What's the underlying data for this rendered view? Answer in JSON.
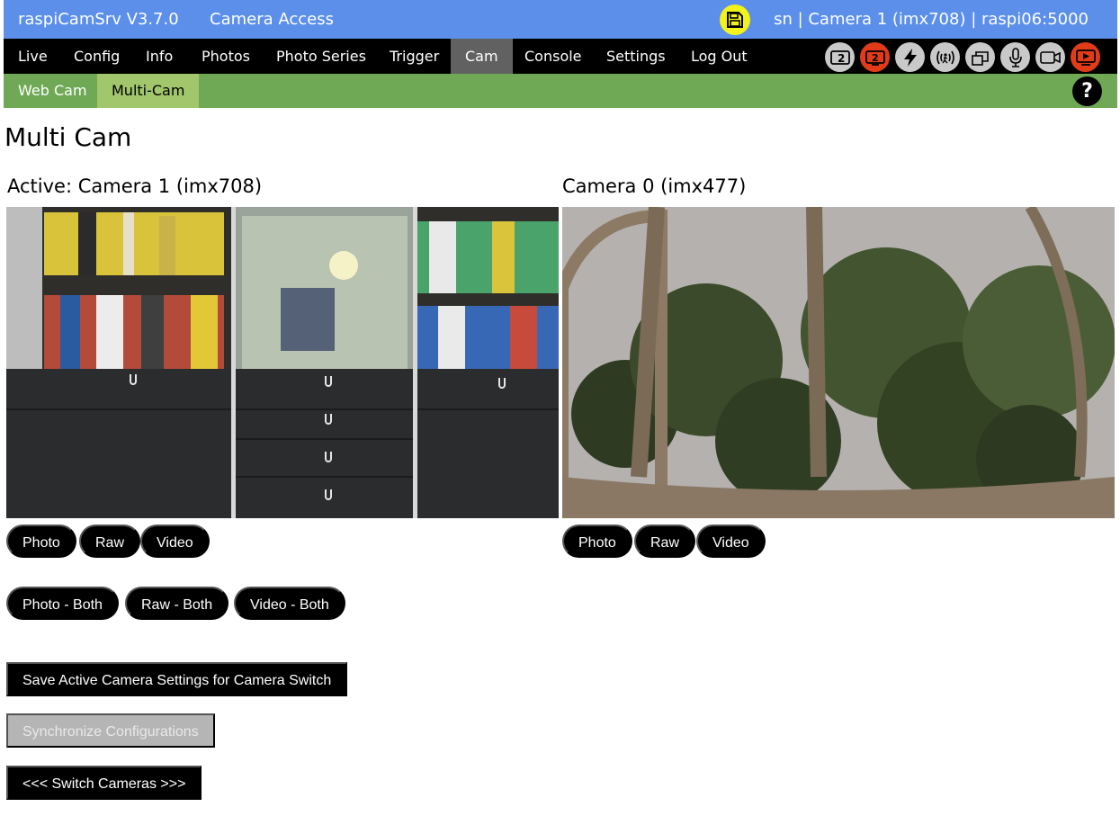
{
  "header": {
    "app_title": "raspiCamSrv V3.7.0",
    "page_name": "Camera Access",
    "status": "sn | Camera 1 (imx708) | raspi06:5000",
    "save_icon": "floppy-disk-icon"
  },
  "mainnav": {
    "items": [
      {
        "label": "Live"
      },
      {
        "label": "Config"
      },
      {
        "label": "Info"
      },
      {
        "label": "Photos"
      },
      {
        "label": "Photo Series"
      },
      {
        "label": "Trigger"
      },
      {
        "label": "Cam"
      },
      {
        "label": "Console"
      },
      {
        "label": "Settings"
      },
      {
        "label": "Log Out"
      }
    ],
    "active": "Cam",
    "status_icons": [
      {
        "name": "dual-camera-icon",
        "label": "2",
        "color": "#c9c9c9"
      },
      {
        "name": "dual-camera-active-icon",
        "label": "2",
        "color": "#e23b18"
      },
      {
        "name": "lightning-icon",
        "color": "#c9c9c9"
      },
      {
        "name": "motion-trigger-icon",
        "color": "#c9c9c9"
      },
      {
        "name": "windows-icon",
        "color": "#c9c9c9"
      },
      {
        "name": "microphone-icon",
        "color": "#c9c9c9"
      },
      {
        "name": "video-camera-icon",
        "color": "#c9c9c9"
      },
      {
        "name": "live-stream-icon",
        "color": "#e23b18"
      }
    ]
  },
  "subnav": {
    "items": [
      {
        "label": "Web Cam"
      },
      {
        "label": "Multi-Cam"
      }
    ],
    "active": "Multi-Cam",
    "help_label": "?"
  },
  "page": {
    "title": "Multi Cam"
  },
  "cameras": [
    {
      "label": "Active: Camera 1 (imx708)",
      "buttons": [
        "Photo",
        "Raw",
        "Video"
      ]
    },
    {
      "label": "Camera 0 (imx477)",
      "buttons": [
        "Photo",
        "Raw",
        "Video"
      ]
    }
  ],
  "both_buttons": [
    "Photo - Both",
    "Raw - Both",
    "Video - Both"
  ],
  "actions": {
    "save_settings": "Save Active Camera Settings for Camera Switch",
    "synchronize": "Synchronize Configurations",
    "switch": "<<< Switch Cameras >>>"
  },
  "colors": {
    "header_bg": "#5b8fea",
    "nav_bg": "#000000",
    "nav_active": "#616161",
    "subnav_bg": "#6fa956",
    "subnav_active": "#a1c66c",
    "save_icon_bg": "#f3f21a",
    "disabled_button": "#b5b5b5"
  }
}
